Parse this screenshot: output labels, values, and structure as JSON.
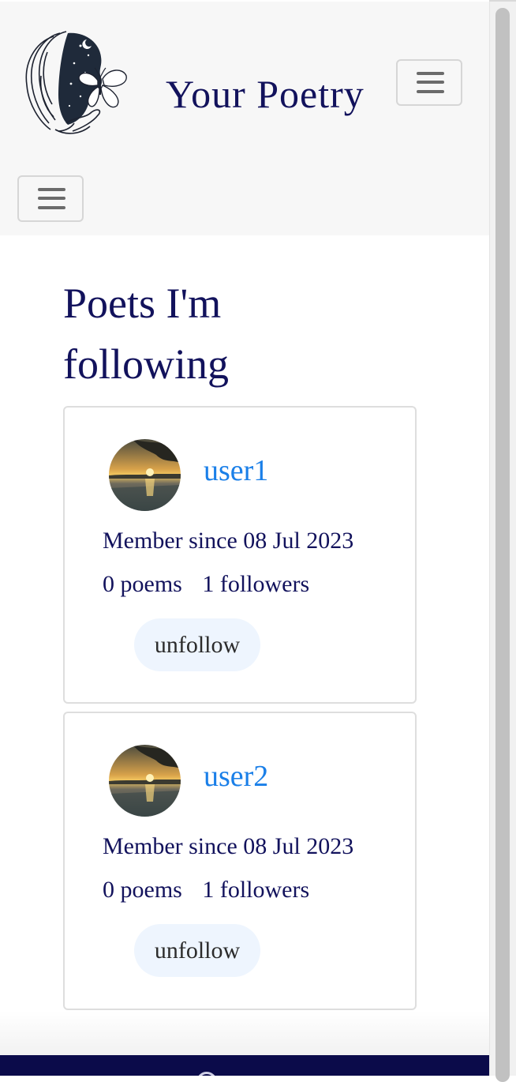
{
  "app": {
    "title": "Your Poetry"
  },
  "header": {
    "brand": "Your Poetry",
    "logo_icon": "woman-butterfly-logo",
    "menu_icon": "hamburger-menu-icon"
  },
  "main": {
    "page_title": "Poets I'm following",
    "poets": [
      {
        "username": "user1",
        "member_since": "Member since 08 Jul 2023",
        "poems": "0 poems",
        "followers": "1 followers",
        "unfollow_label": "unfollow"
      },
      {
        "username": "user2",
        "member_since": "Member since 08 Jul 2023",
        "poems": "0 poems",
        "followers": "1 followers",
        "unfollow_label": "unfollow"
      }
    ]
  },
  "colors": {
    "brand_navy": "#12125c",
    "link_blue": "#1a7fe8",
    "button_bg": "#eef5fe",
    "navbar_bg": "#f7f7f7",
    "footer_bg": "#0b0b4a"
  }
}
